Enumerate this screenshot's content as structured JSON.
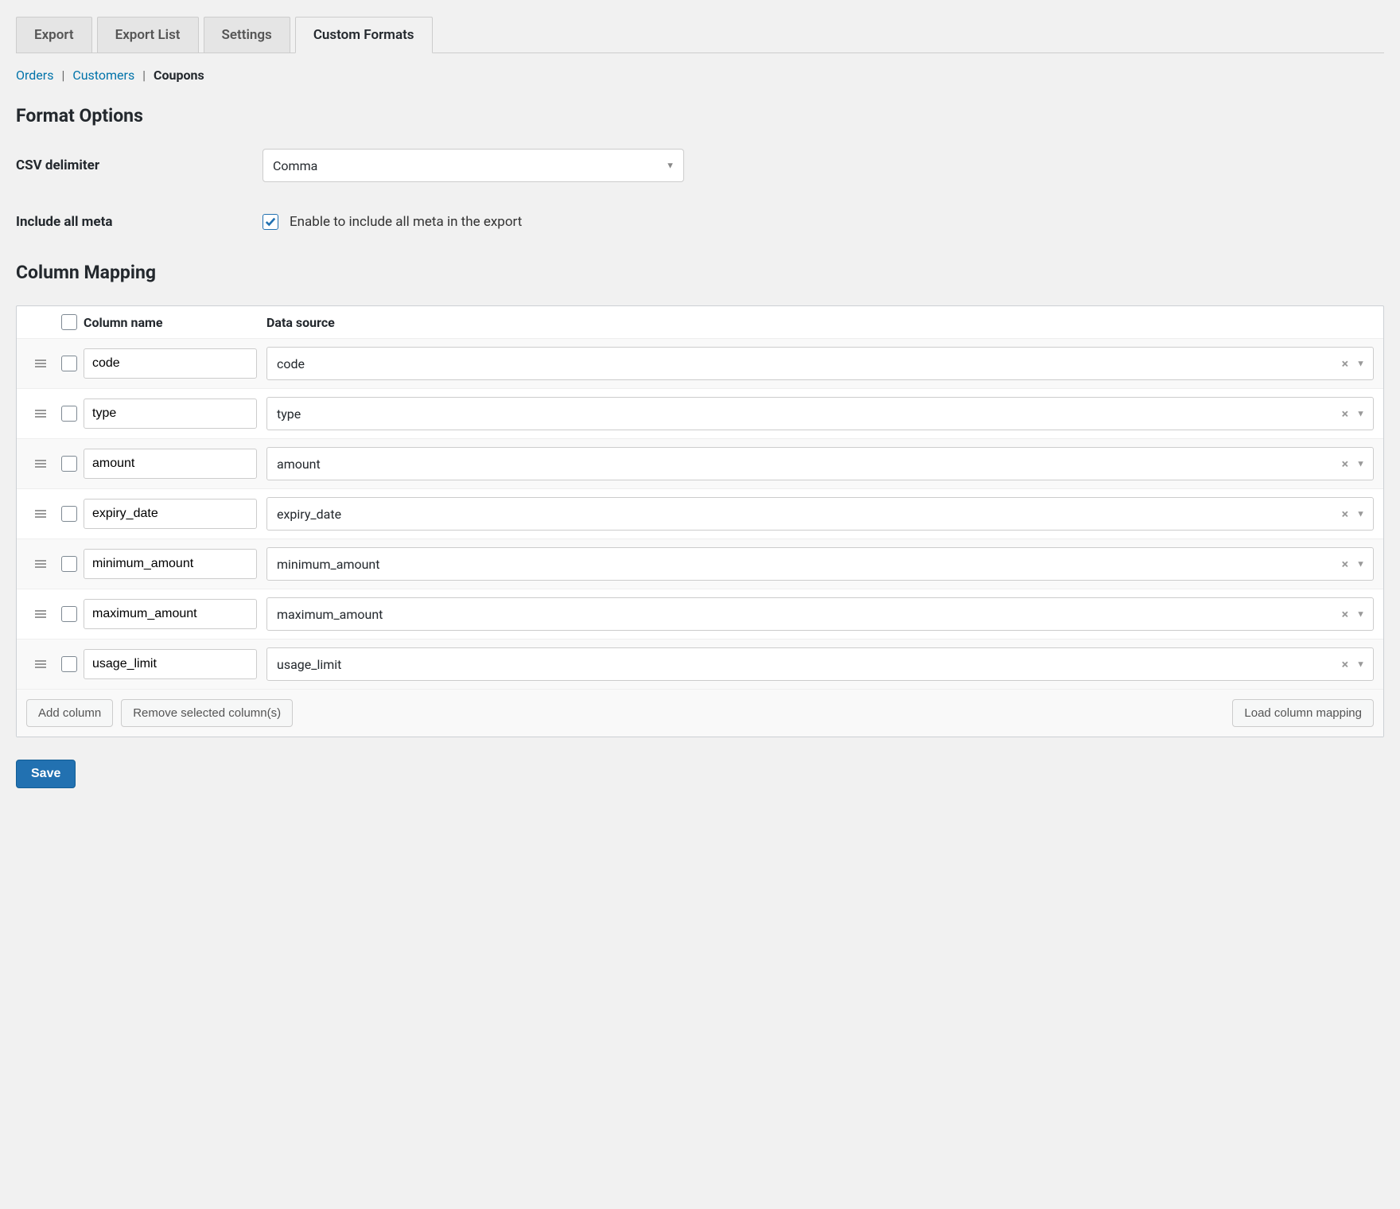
{
  "tabs": {
    "items": [
      "Export",
      "Export List",
      "Settings",
      "Custom Formats"
    ],
    "active_index": 3
  },
  "subtabs": {
    "items": [
      "Orders",
      "Customers",
      "Coupons"
    ],
    "active_index": 2
  },
  "sections": {
    "format_options": "Format Options",
    "column_mapping": "Column Mapping"
  },
  "csv_delimiter": {
    "label": "CSV delimiter",
    "value": "Comma"
  },
  "include_meta": {
    "label": "Include all meta",
    "checked": true,
    "text": "Enable to include all meta in the export"
  },
  "mapping": {
    "headers": {
      "name": "Column name",
      "source": "Data source"
    },
    "rows": [
      {
        "name": "code",
        "source": "code"
      },
      {
        "name": "type",
        "source": "type"
      },
      {
        "name": "amount",
        "source": "amount"
      },
      {
        "name": "expiry_date",
        "source": "expiry_date"
      },
      {
        "name": "minimum_amount",
        "source": "minimum_amount"
      },
      {
        "name": "maximum_amount",
        "source": "maximum_amount"
      },
      {
        "name": "usage_limit",
        "source": "usage_limit"
      }
    ],
    "footer": {
      "add": "Add column",
      "remove": "Remove selected column(s)",
      "load": "Load column mapping"
    }
  },
  "save_button": "Save"
}
